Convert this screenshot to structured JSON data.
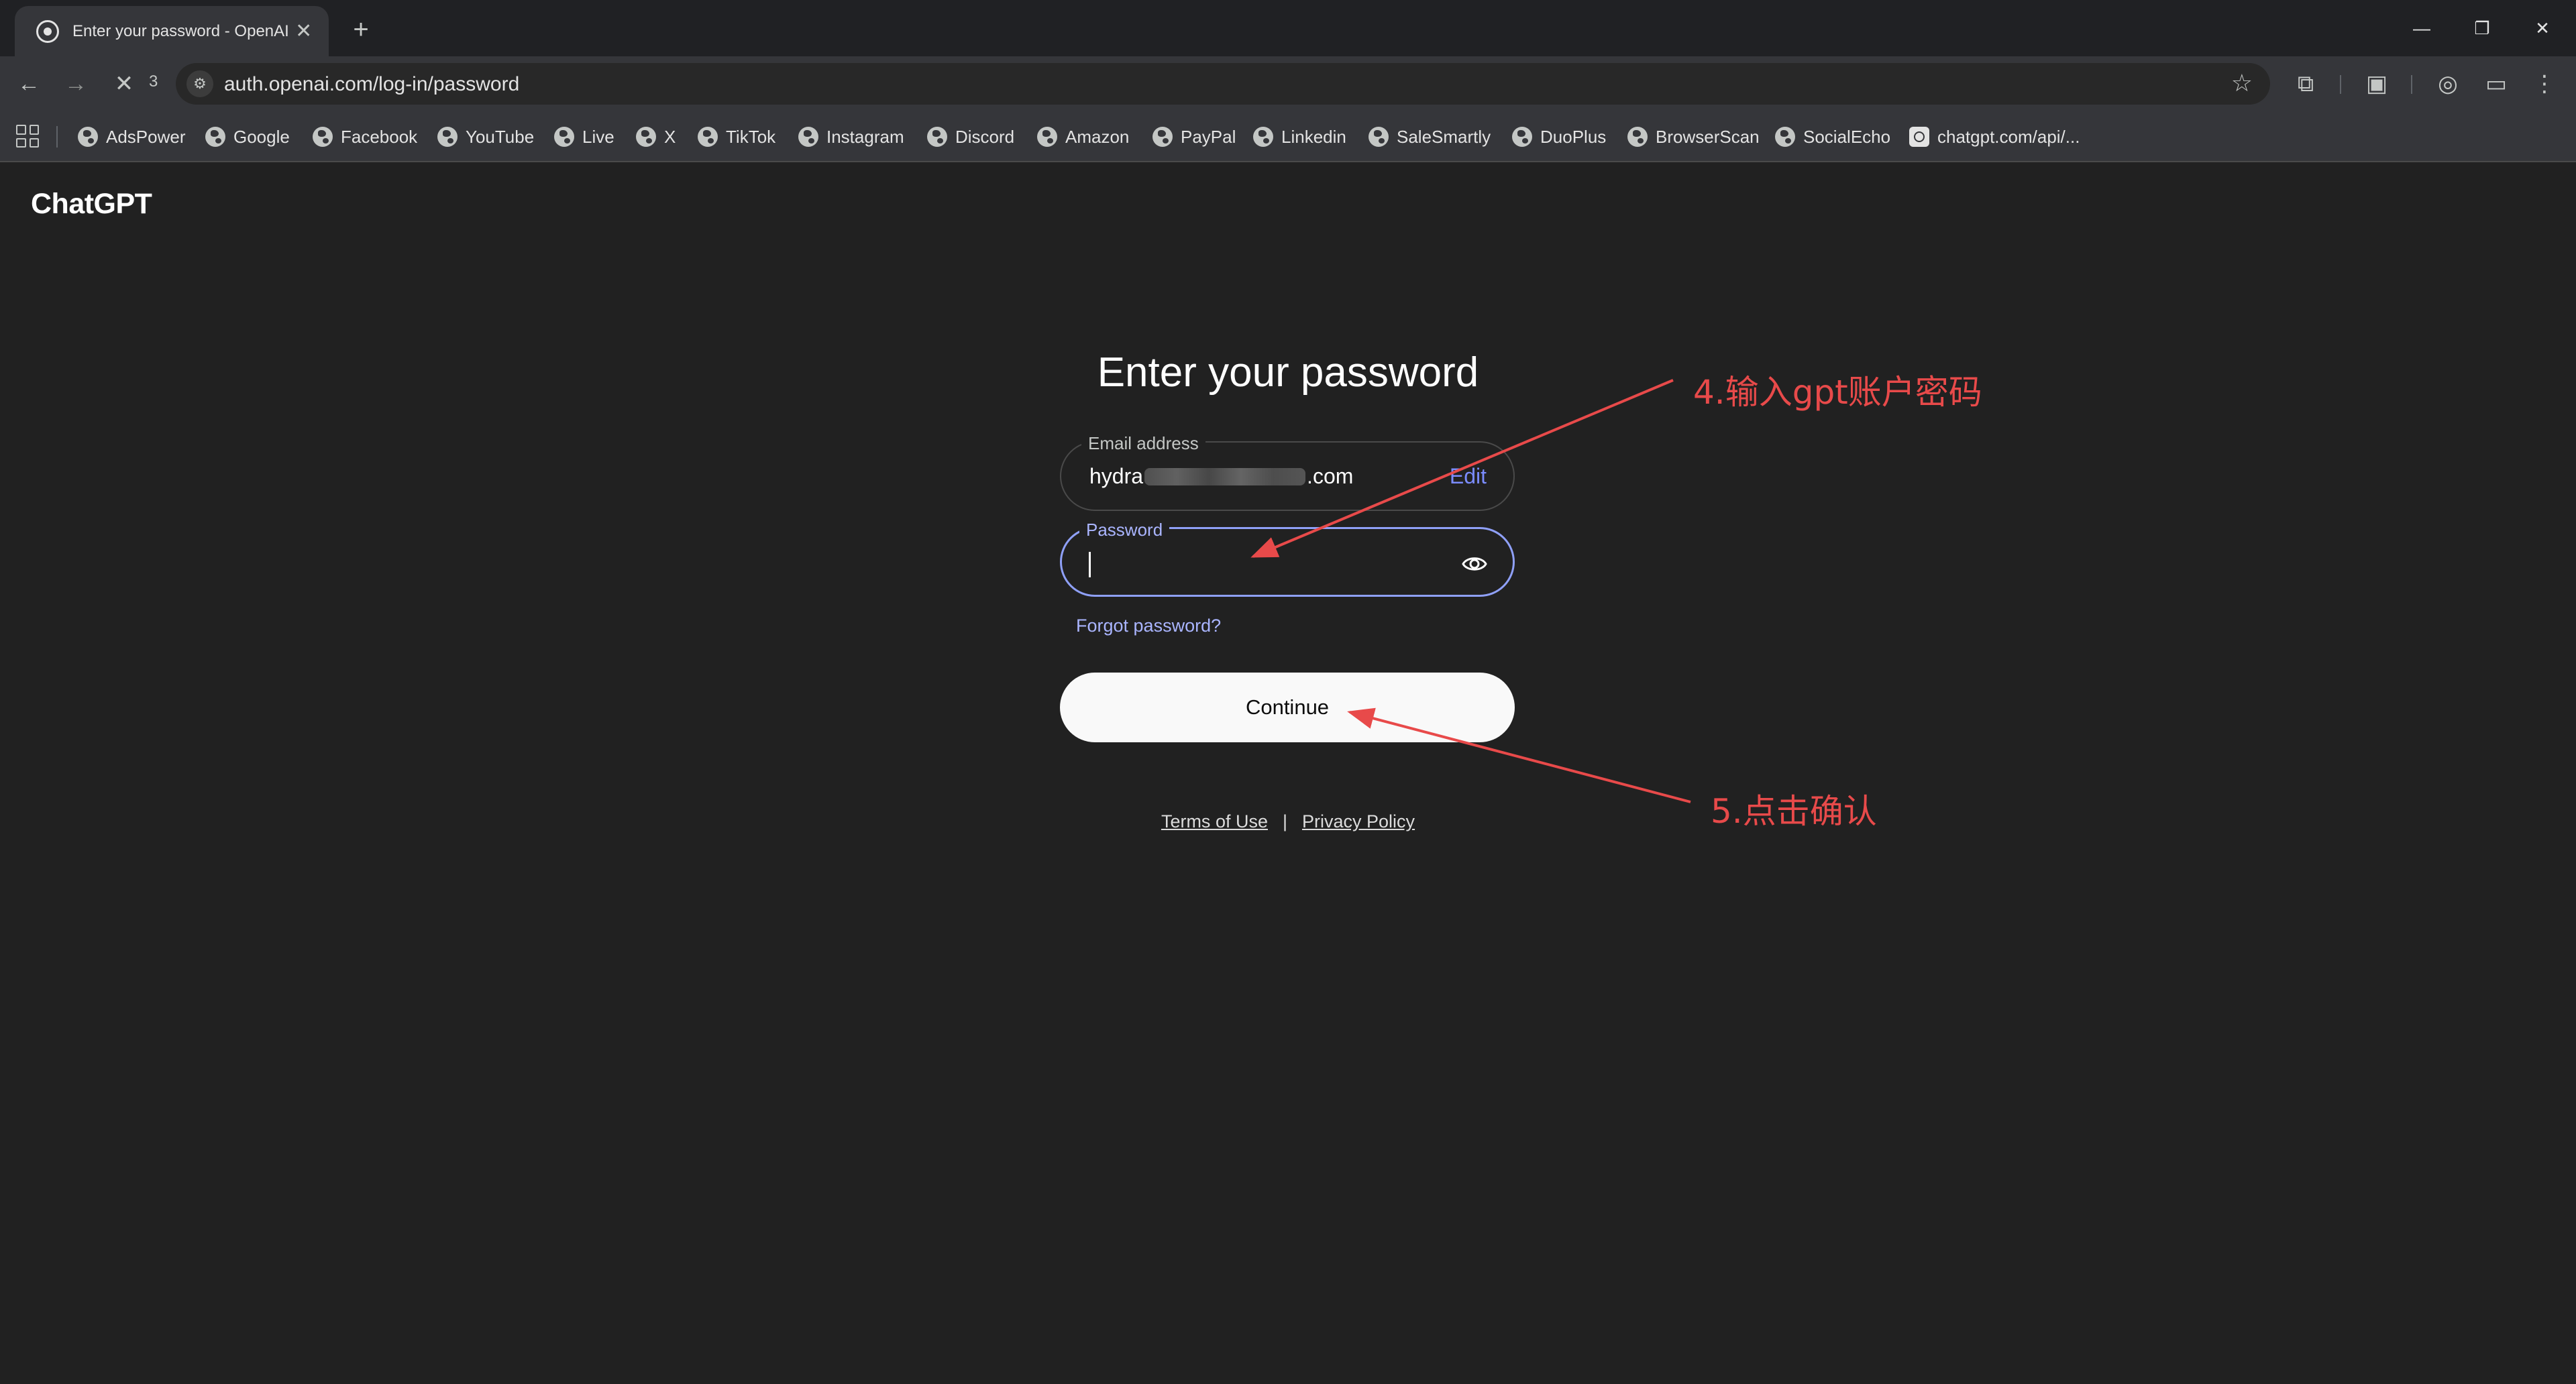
{
  "browser": {
    "tab_title": "Enter your password - OpenAI",
    "reload_count": "3",
    "url": "auth.openai.com/log-in/password",
    "bookmarks": [
      {
        "label": "AdsPower"
      },
      {
        "label": "Google"
      },
      {
        "label": "Facebook"
      },
      {
        "label": "YouTube"
      },
      {
        "label": "Live"
      },
      {
        "label": "X"
      },
      {
        "label": "TikTok"
      },
      {
        "label": "Instagram"
      },
      {
        "label": "Discord"
      },
      {
        "label": "Amazon"
      },
      {
        "label": "PayPal"
      },
      {
        "label": "Linkedin"
      },
      {
        "label": "SaleSmartly"
      },
      {
        "label": "DuoPlus"
      },
      {
        "label": "BrowserScan"
      },
      {
        "label": "SocialEcho"
      },
      {
        "label": "chatgpt.com/api/..."
      }
    ]
  },
  "page": {
    "brand": "ChatGPT",
    "heading": "Enter your password",
    "email": {
      "label": "Email address",
      "value_prefix": "hydra",
      "value_suffix": ".com",
      "edit_label": "Edit"
    },
    "password": {
      "label": "Password",
      "value": ""
    },
    "forgot_label": "Forgot password?",
    "continue_label": "Continue",
    "footer": {
      "terms": "Terms of Use",
      "separator": "|",
      "privacy": "Privacy Policy"
    }
  },
  "annotations": {
    "step4": "4.输入gpt账户密码",
    "step5": "5.点击确认",
    "color": "#e84a4a"
  }
}
